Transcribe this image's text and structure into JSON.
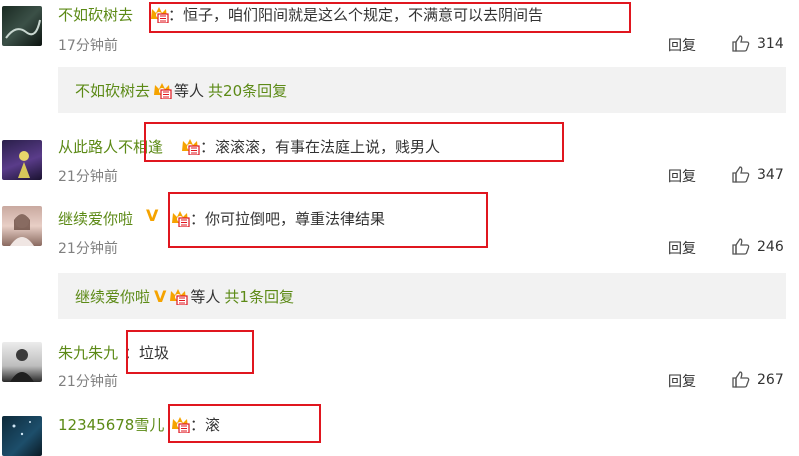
{
  "comments": [
    {
      "user": "不如砍树去",
      "text": "：恒子，咱们阳间就是这么个规定，不满意可以去阴间告",
      "time": "17分钟前",
      "reply_label": "回复",
      "likes": "314",
      "avatar_icon": "dark-landscape-avatar"
    },
    {
      "user": "从此路人不相逢",
      "text": "：滚滚滚，有事在法庭上说，贱男人",
      "time": "21分钟前",
      "reply_label": "回复",
      "likes": "347",
      "avatar_icon": "purple-figure-avatar"
    },
    {
      "user": "继续爱你啦",
      "text": "：你可拉倒吧，尊重法律结果",
      "time": "21分钟前",
      "reply_label": "回复",
      "likes": "246",
      "avatar_icon": "girl-portrait-avatar",
      "vip": "V"
    },
    {
      "user": "朱九朱九",
      "text": "：垃圾",
      "time": "21分钟前",
      "reply_label": "回复",
      "likes": "267",
      "avatar_icon": "monochrome-person-avatar"
    },
    {
      "user": "12345678雪儿",
      "text": "：滚",
      "avatar_icon": "night-scene-avatar"
    }
  ],
  "sub_replies": [
    {
      "user": "不如砍树去",
      "middle": "等人",
      "count": "共20条回复"
    },
    {
      "user": "继续爱你啦",
      "vip": "V",
      "middle": "等人",
      "count": "共1条回复"
    }
  ],
  "colors": {
    "username": "#5c8a16",
    "highlight_box": "#e0161f",
    "subreply_bg": "#f2f2f2",
    "vip": "#f5a300",
    "badge": "#f0a000"
  }
}
